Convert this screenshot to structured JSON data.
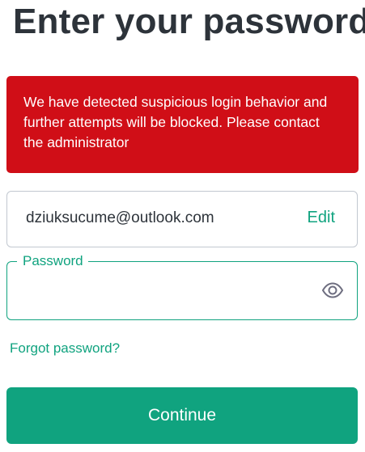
{
  "header": {
    "title": "Enter your password"
  },
  "alert": {
    "message": "We have detected suspicious login behavior and further attempts will be blocked. Please contact the administrator",
    "color": "#d00e17"
  },
  "email": {
    "value": "dziuksucume@outlook.com",
    "edit_label": "Edit"
  },
  "password": {
    "label": "Password",
    "value": "",
    "toggle_icon": "eye-icon"
  },
  "links": {
    "forgot_password": "Forgot password?"
  },
  "actions": {
    "continue_label": "Continue"
  },
  "colors": {
    "accent": "#10a37f",
    "error": "#d00e17",
    "text": "#2d333a"
  }
}
